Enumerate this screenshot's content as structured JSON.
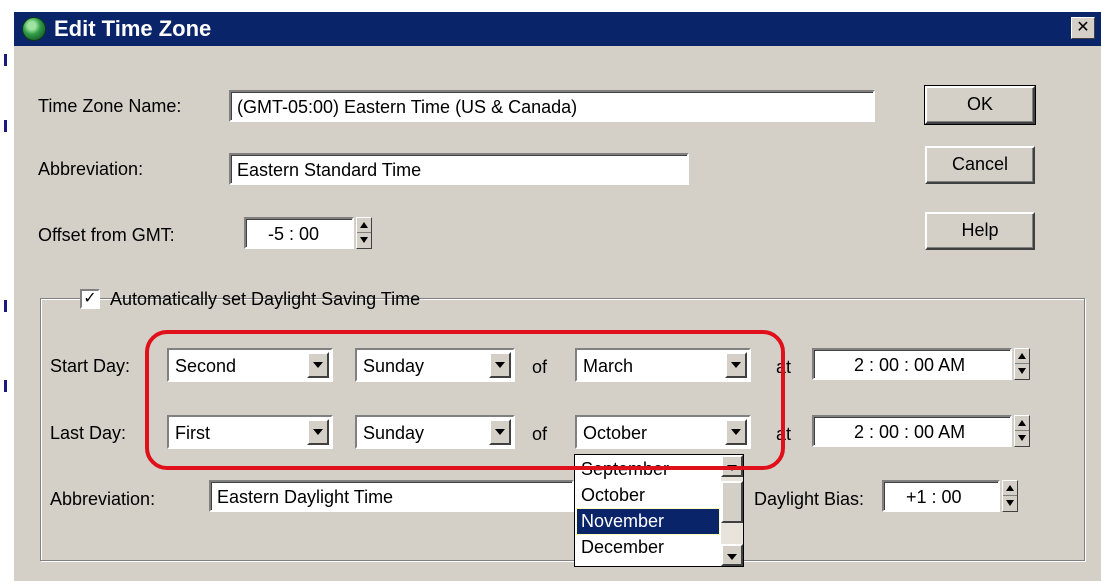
{
  "window": {
    "title": "Edit Time Zone",
    "close_glyph": "✕"
  },
  "colors": {
    "titlebar": "#0a246a",
    "dialog_bg": "#d4d0c8",
    "highlight_ring": "#e0101a"
  },
  "icons": {
    "app": "globe-icon",
    "close": "close-icon",
    "spin": "spin-arrows-icon",
    "dropdown": "dropdown-arrow-icon"
  },
  "labels": {
    "time_zone_name": "Time Zone Name:",
    "abbreviation": "Abbreviation:",
    "offset_from_gmt": "Offset from GMT:",
    "start_day": "Start Day:",
    "last_day": "Last Day:",
    "of_1": "of",
    "of_2": "of",
    "at_1": "at",
    "at_2": "at",
    "dst_abbreviation": "Abbreviation:",
    "daylight_bias": "Daylight Bias:"
  },
  "fields": {
    "time_zone_name": "(GMT-05:00) Eastern Time (US & Canada)",
    "abbreviation": "Eastern Standard Time",
    "offset": "-5 : 00",
    "dst_abbreviation": "Eastern Daylight Time",
    "daylight_bias": "+1 : 00",
    "start_time": "2 : 00 : 00 AM",
    "last_time": "2 : 00 : 00 AM"
  },
  "buttons": {
    "ok": "OK",
    "cancel": "Cancel",
    "help": "Help"
  },
  "dst": {
    "checkbox_label": "Automatically set Daylight Saving Time",
    "checked": true,
    "check_mark": "✓",
    "start": {
      "week": "Second",
      "weekday": "Sunday",
      "month": "March"
    },
    "last": {
      "week": "First",
      "weekday": "Sunday",
      "month": "October"
    }
  },
  "month_dropdown": {
    "items": [
      "September",
      "October",
      "November",
      "December"
    ],
    "selected": "November"
  }
}
